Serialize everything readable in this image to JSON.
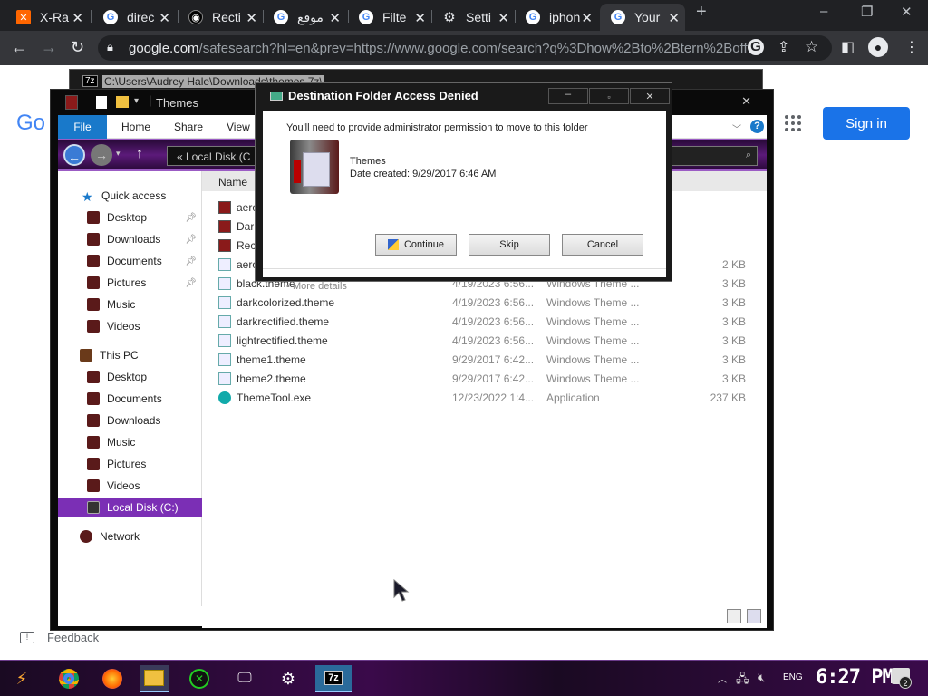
{
  "browser": {
    "tabs": [
      {
        "title": "X-Ra",
        "favicon": "x-ray-icon"
      },
      {
        "title": "direc",
        "favicon": "google-icon"
      },
      {
        "title": "Recti",
        "favicon": "github-icon"
      },
      {
        "title": "موقع",
        "favicon": "google-icon"
      },
      {
        "title": "Filte",
        "favicon": "google-icon"
      },
      {
        "title": "Setti",
        "favicon": "gear-icon"
      },
      {
        "title": "iphon",
        "favicon": "google-icon"
      },
      {
        "title": "Your",
        "favicon": "google-icon"
      }
    ],
    "url_domain": "google.com",
    "url_rest": "/safesearch?hl=en&prev=https://www.google.com/search?q%3Dhow%2Bto%2Btern%2Boff..."
  },
  "google": {
    "logo_partial": "Go",
    "sign_in": "Sign in",
    "feedback": "Feedback"
  },
  "sevenzip_window": {
    "path": "C:\\Users\\Audrey Hale\\Downloads\\themes.7z\\"
  },
  "explorer": {
    "title": "Themes",
    "ribbon": {
      "file": "File",
      "home": "Home",
      "share": "Share",
      "view": "View"
    },
    "address": "« Local Disk (C",
    "nav": {
      "quick_access": "Quick access",
      "qa_items": [
        "Desktop",
        "Downloads",
        "Documents",
        "Pictures",
        "Music",
        "Videos"
      ],
      "this_pc": "This PC",
      "pc_items": [
        "Desktop",
        "Documents",
        "Downloads",
        "Music",
        "Pictures",
        "Videos"
      ],
      "local_disk": "Local Disk (C:)",
      "network": "Network"
    },
    "columns": {
      "name": "Name"
    },
    "files": [
      {
        "name": "aero",
        "date": "",
        "type": "",
        "size": ""
      },
      {
        "name": "Dar",
        "date": "",
        "type": "",
        "size": ""
      },
      {
        "name": "Rect",
        "date": "",
        "type": "",
        "size": ""
      },
      {
        "name": "aero",
        "date": "",
        "type": "",
        "size": "2 KB"
      },
      {
        "name": "black.theme",
        "date": "4/19/2023 6:56...",
        "type": "Windows Theme ...",
        "size": "3 KB"
      },
      {
        "name": "darkcolorized.theme",
        "date": "4/19/2023 6:56...",
        "type": "Windows Theme ...",
        "size": "3 KB"
      },
      {
        "name": "darkrectified.theme",
        "date": "4/19/2023 6:56...",
        "type": "Windows Theme ...",
        "size": "3 KB"
      },
      {
        "name": "lightrectified.theme",
        "date": "4/19/2023 6:56...",
        "type": "Windows Theme ...",
        "size": "3 KB"
      },
      {
        "name": "theme1.theme",
        "date": "9/29/2017 6:42...",
        "type": "Windows Theme ...",
        "size": "3 KB"
      },
      {
        "name": "theme2.theme",
        "date": "9/29/2017 6:42...",
        "type": "Windows Theme ...",
        "size": "3 KB"
      },
      {
        "name": "ThemeTool.exe",
        "date": "12/23/2022 1:4...",
        "type": "Application",
        "size": "237 KB"
      }
    ]
  },
  "dialog": {
    "title": "Destination Folder Access Denied",
    "message": "You'll need to provide administrator permission to move to this folder",
    "folder_name": "Themes",
    "date_created": "Date created: 9/29/2017 6:46 AM",
    "continue": "Continue",
    "skip": "Skip",
    "cancel": "Cancel",
    "more_details": "More details"
  },
  "taskbar": {
    "language": "ENG",
    "time": "6:27 PM",
    "notifications": "2",
    "sevenzip_label": "7z"
  },
  "colors": {
    "accent_purple": "#7b2fb5",
    "chrome_dark": "#202124",
    "google_blue": "#1a73e8"
  }
}
